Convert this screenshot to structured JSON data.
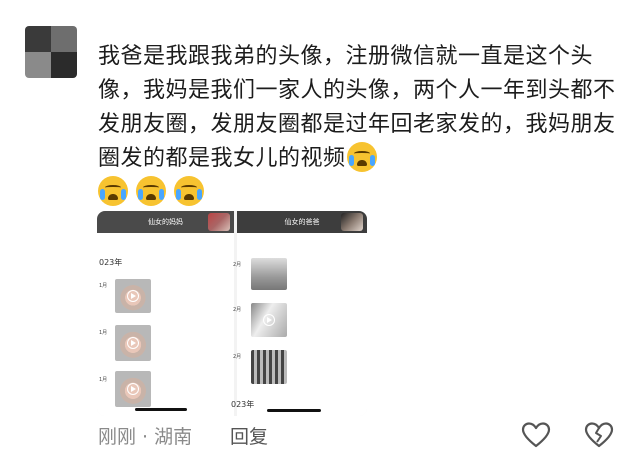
{
  "comment": {
    "text": "我爸是我跟我弟的头像，注册微信就一直是这个头像，我妈是我们一家人的头像，两个人一年到头都不发朋友圈，发朋友圈都是过年回老家发的，我妈朋友圈发的都是我女儿的视频",
    "inline_emoji": "loudly-crying-face",
    "trailing_emoji_count": 3
  },
  "attachment": {
    "left_panel": {
      "title": "仙女的妈妈",
      "year": "023年",
      "months": [
        "1月",
        "1月",
        "1月"
      ]
    },
    "right_panel": {
      "title": "仙女的爸爸",
      "months": [
        "2月",
        "2月",
        "2月"
      ],
      "year": "023年"
    }
  },
  "footer": {
    "time_location": "刚刚 · 湖南",
    "reply_label": "回复",
    "like_icon": "heart-outline-icon",
    "dislike_icon": "broken-heart-icon"
  }
}
